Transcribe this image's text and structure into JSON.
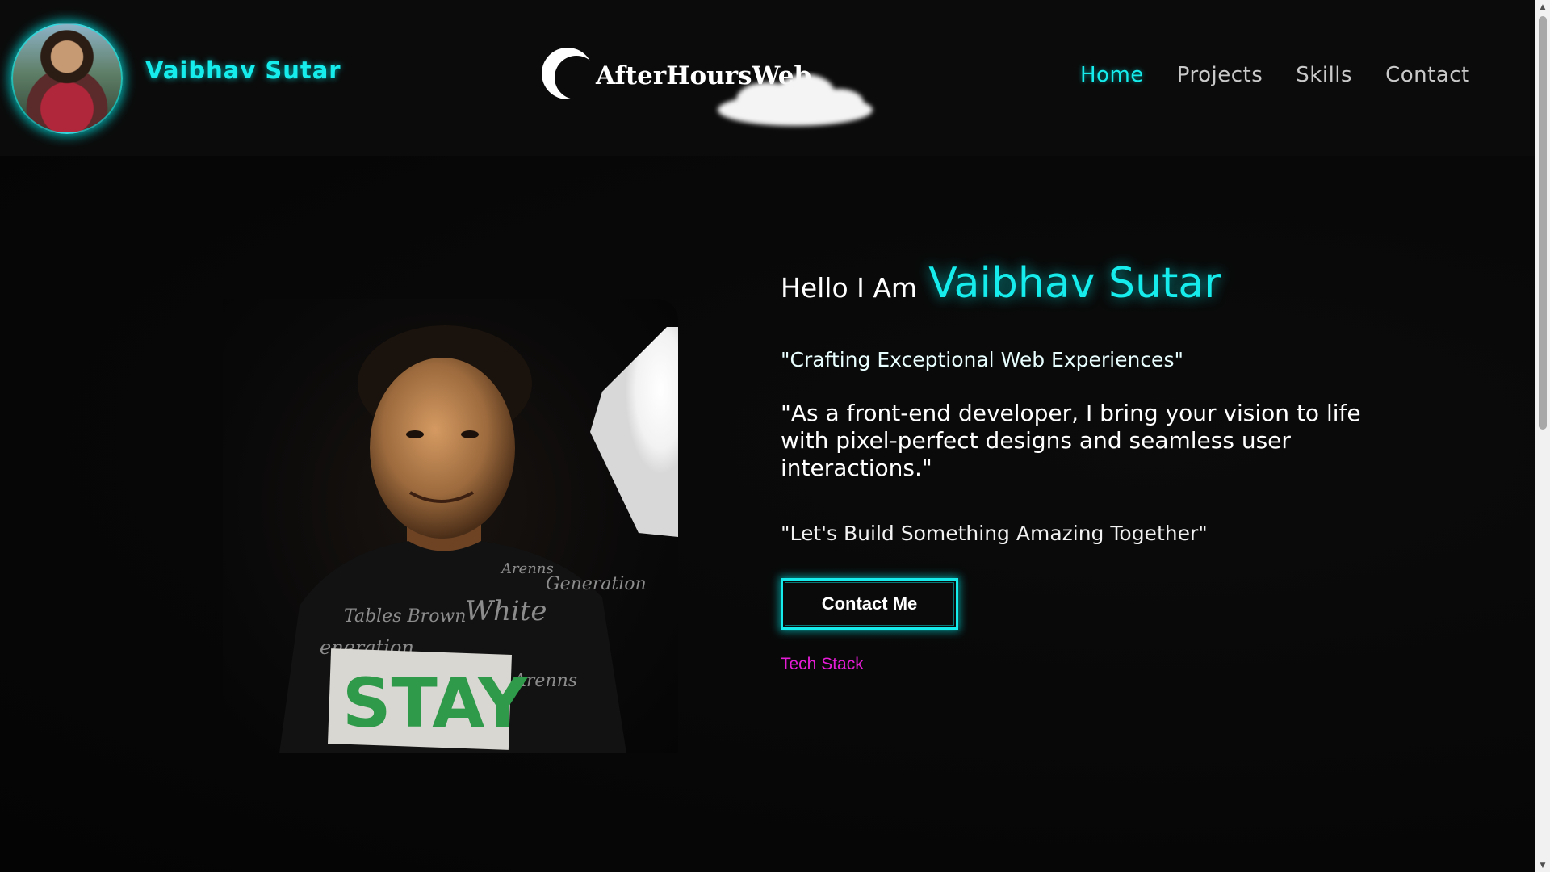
{
  "header": {
    "brand_name": "Vaibhav Sutar",
    "logo_text": "AfterHoursWeb",
    "nav": [
      {
        "label": "Home",
        "active": true
      },
      {
        "label": "Projects",
        "active": false
      },
      {
        "label": "Skills",
        "active": false
      },
      {
        "label": "Contact",
        "active": false
      }
    ]
  },
  "hero": {
    "greeting_prefix": "Hello I Am",
    "greeting_name": "Vaibhav Sutar",
    "tagline": "\"Crafting Exceptional Web Experiences\"",
    "description": "\"As a front-end developer, I bring your vision to life with pixel-perfect designs and seamless user interactions.\"",
    "cta_text": "\"Let's Build Something Amazing Together\"",
    "contact_button_label": "Contact Me",
    "tech_stack_link": "Tech Stack",
    "portrait_shirt_text": "STAY"
  },
  "icons": [
    "avatar-image",
    "crescent-moon-icon",
    "cloud-icon"
  ],
  "colors": {
    "accent_cyan": "#16ecec",
    "link_magenta": "#e51cd6",
    "background": "#060606",
    "header_bg": "#0b0b0b"
  }
}
